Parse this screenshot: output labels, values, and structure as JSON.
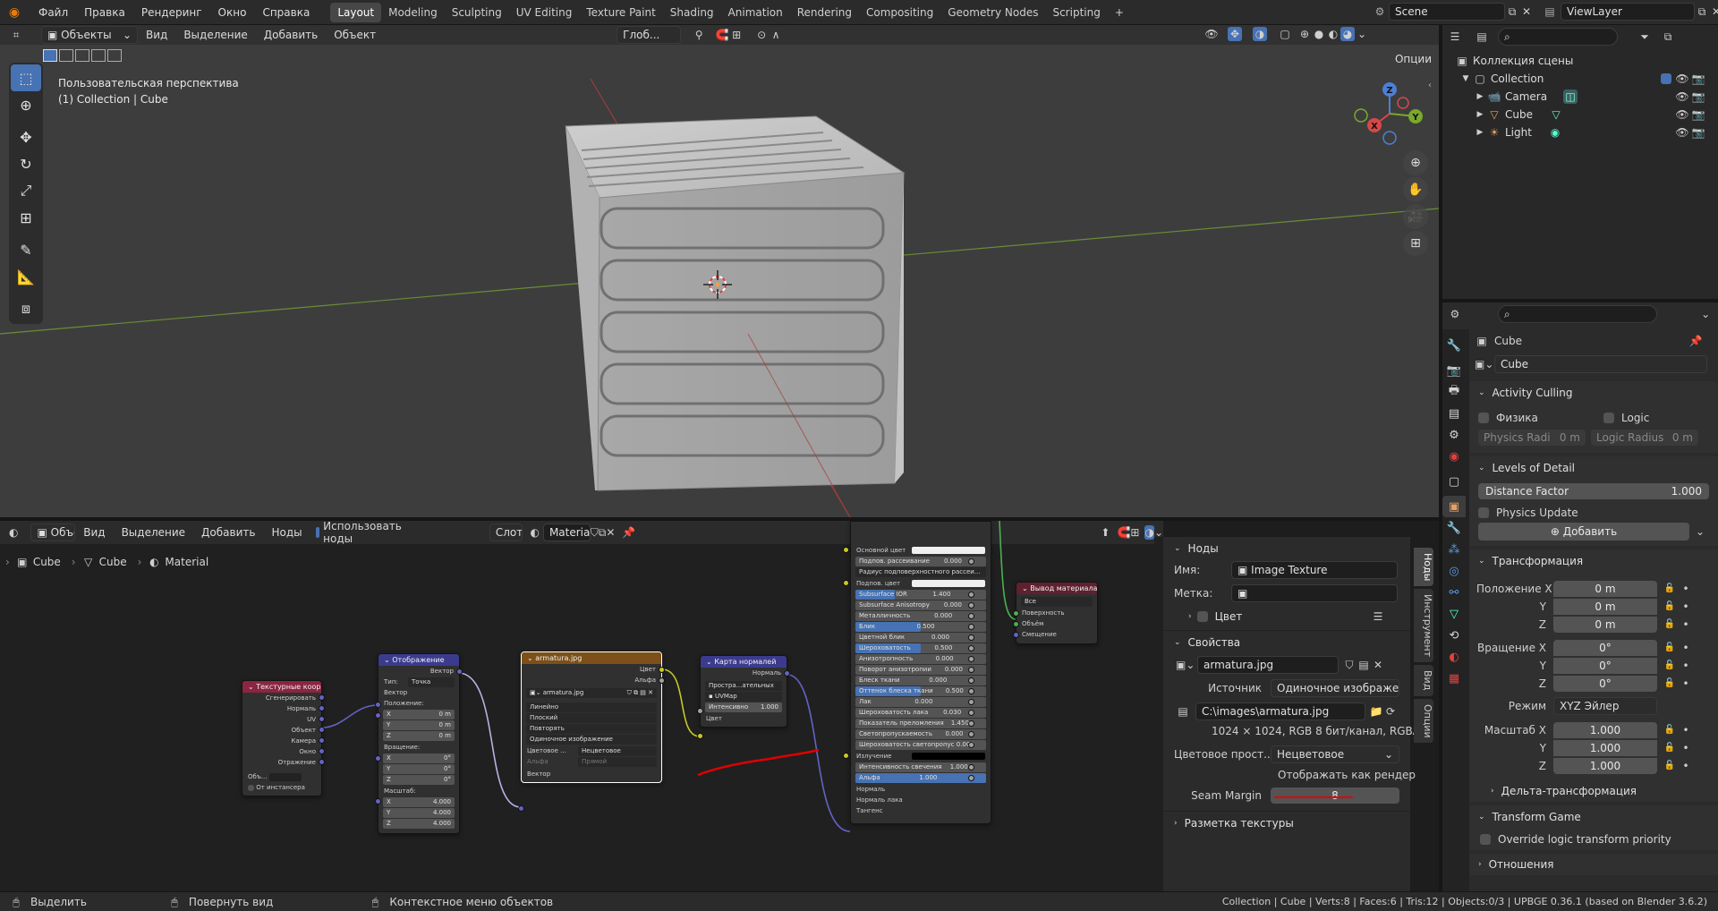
{
  "topbar": {
    "menus": [
      "Файл",
      "Правка",
      "Рендеринг",
      "Окно",
      "Справка"
    ],
    "workspaces": [
      "Layout",
      "Modeling",
      "Sculpting",
      "UV Editing",
      "Texture Paint",
      "Shading",
      "Animation",
      "Rendering",
      "Compositing",
      "Geometry Nodes",
      "Scripting"
    ],
    "add_workspace": "+",
    "scene": "Scene",
    "view_layer": "ViewLayer"
  },
  "viewport": {
    "mode": "Объекты",
    "menus": [
      "Вид",
      "Выделение",
      "Добавить",
      "Объект"
    ],
    "transform_orientation": "Глоб...",
    "options": "Опции",
    "overlay_title": "Пользовательская перспектива",
    "overlay_subtitle": "(1) Collection | Cube",
    "gizmo_labels": {
      "x": "X",
      "y": "Y",
      "z": "Z"
    }
  },
  "outliner": {
    "root": "Коллекция сцены",
    "collection": "Collection",
    "items": [
      "Camera",
      "Cube",
      "Light"
    ]
  },
  "node_editor": {
    "mode": "Объект",
    "menus": [
      "Вид",
      "Выделение",
      "Добавить",
      "Ноды"
    ],
    "use_nodes": "Использовать ноды",
    "slot": "Слот 1",
    "material": "Material",
    "breadcrumb": [
      "Cube",
      "Cube",
      "Material"
    ],
    "nodes": {
      "texcoord": {
        "title": "Текстурные коорд...",
        "outputs": [
          "Сгенерировать",
          "Нормаль",
          "UV",
          "Объект",
          "Камера",
          "Окно",
          "Отражение"
        ],
        "object_label": "Объ...",
        "from_instancer": "От инстансера"
      },
      "mapping": {
        "title": "Отображение",
        "output": "Вектор",
        "type_label": "Тип:",
        "type_value": "Точка",
        "vector": "Вектор",
        "location": "Положение:",
        "loc": [
          [
            "X",
            "0 m"
          ],
          [
            "Y",
            "0 m"
          ],
          [
            "Z",
            "0 m"
          ]
        ],
        "rotation": "Вращение:",
        "rot": [
          [
            "X",
            "0°"
          ],
          [
            "Y",
            "0°"
          ],
          [
            "Z",
            "0°"
          ]
        ],
        "scale": "Масштаб:",
        "scl": [
          [
            "X",
            "4.000"
          ],
          [
            "Y",
            "4.000"
          ],
          [
            "Z",
            "4.000"
          ]
        ]
      },
      "image": {
        "title": "armatura.jpg",
        "outputs": [
          "Цвет",
          "Альфа"
        ],
        "image_name": "armatura.jpg",
        "interpolation": "Линейно",
        "projection": "Плоский",
        "extension": "Повторять",
        "source": "Одиночное изображение",
        "colorspace_label": "Цветовое ...",
        "colorspace_value": "Нецветовое",
        "alpha_label": "Альфа",
        "alpha_value": "Прямой",
        "vector_in": "Вектор"
      },
      "normalmap": {
        "title": "Карта нормалей",
        "output": "Нормаль",
        "space": "Простра...ательных",
        "uvmap": "UVMap",
        "strength_label": "Интенсивно",
        "strength_value": "1.000",
        "color_in": "Цвет"
      },
      "bsdf": {
        "rows": [
          {
            "label": "Основной цвет",
            "kind": "color",
            "color": "#f0f0f0"
          },
          {
            "label": "Подпов. рассеивание",
            "value": "0.000"
          },
          {
            "label": "Радиус подповерхностного рассеи...",
            "kind": "dd"
          },
          {
            "label": "Подпов. цвет",
            "kind": "color",
            "color": "#f0f0f0"
          },
          {
            "label": "Subsurface IOR",
            "value": "1.400",
            "fill": 0.3
          },
          {
            "label": "Subsurface Anisotropy",
            "value": "0.000"
          },
          {
            "label": "Металличность",
            "value": "0.000"
          },
          {
            "label": "Блик",
            "value": "0.500",
            "fill": 0.5
          },
          {
            "label": "Цветной блик",
            "value": "0.000"
          },
          {
            "label": "Шероховатость",
            "value": "0.500",
            "fill": 0.5
          },
          {
            "label": "Анизотропность",
            "value": "0.000"
          },
          {
            "label": "Поворот анизотропии",
            "value": "0.000"
          },
          {
            "label": "Блеск ткани",
            "value": "0.000"
          },
          {
            "label": "Оттенок блеска ткани",
            "value": "0.500",
            "fill": 0.5
          },
          {
            "label": "Лак",
            "value": "0.000"
          },
          {
            "label": "Шероховатость лака",
            "value": "0.030"
          },
          {
            "label": "Показатель преломления",
            "value": "1.450"
          },
          {
            "label": "Светопропускаемость",
            "value": "0.000"
          },
          {
            "label": "Шероховатость светопропус",
            "value": "0.000"
          },
          {
            "label": "Излучение",
            "kind": "color",
            "color": "#000000"
          },
          {
            "label": "Интенсивность свечения",
            "value": "1.000"
          },
          {
            "label": "Альфа",
            "value": "1.000",
            "fill": 1.0
          },
          {
            "label": "Нормаль",
            "kind": "socket"
          },
          {
            "label": "Нормаль лака",
            "kind": "socket"
          },
          {
            "label": "Тангенс",
            "kind": "socket"
          }
        ]
      },
      "output": {
        "title": "Вывод материала",
        "target": "Все",
        "inputs": [
          "Поверхность",
          "Объём",
          "Смещение"
        ]
      }
    }
  },
  "npanel": {
    "nodes_header": "Ноды",
    "name_label": "Имя:",
    "name_value": "Image Texture",
    "label_label": "Метка:",
    "label_value": "",
    "color_header": "Цвет",
    "props_header": "Свойства",
    "image_name": "armatura.jpg",
    "source_label": "Источник",
    "source_value": "Одиночное изображе...",
    "filepath": "C:\\images\\armatura.jpg",
    "info": "1024 × 1024,  RGB 8 бит/канал,  RGBA8",
    "colorspace_label": "Цветовое прост...",
    "colorspace_value": "Нецветовое",
    "view_as_render": "Отображать как рендер",
    "seam_label": "Seam Margin",
    "seam_value": "8",
    "texmap_header": "Разметка текстуры",
    "tabs": [
      "Ноды",
      "Инструмент",
      "Вид",
      "Опции"
    ]
  },
  "properties": {
    "object_name": "Cube",
    "data_name": "Cube",
    "activity_culling": "Activity Culling",
    "physics": "Физика",
    "logic": "Logic",
    "physics_radius_label": "Physics Radi",
    "physics_radius_value": "0 m",
    "logic_radius_label": "Logic Radius",
    "logic_radius_value": "0 m",
    "lod": "Levels of Detail",
    "distance_factor_label": "Distance Factor",
    "distance_factor_value": "1.000",
    "physics_update": "Physics Update",
    "add_button": "Добавить",
    "transform": "Трансформация",
    "location_label": "Положение X",
    "location": [
      "0 m",
      "0 m",
      "0 m"
    ],
    "rotation_label": "Вращение X",
    "rotation": [
      "0°",
      "0°",
      "0°"
    ],
    "mode_label": "Режим",
    "mode_value": "XYZ Эйлер",
    "scale_label": "Масштаб X",
    "scale": [
      "1.000",
      "1.000",
      "1.000"
    ],
    "axis_y": "Y",
    "axis_z": "Z",
    "delta": "Дельта-трансформация",
    "transform_game": "Transform Game",
    "override": "Override logic transform priority",
    "relations": "Отношения"
  },
  "statusbar": {
    "select": "Выделить",
    "rotate": "Повернуть вид",
    "context": "Контекстное меню объектов",
    "stats": "Collection | Cube | Verts:8 | Faces:6 | Tris:12 | Objects:0/3 | UPBGE 0.36.1 (based on Blender 3.6.2)"
  },
  "colors": {
    "accent": "#4772b3",
    "node_texture": "#7c5018",
    "node_vector": "#3b3b8e",
    "node_input": "#8b2542",
    "node_output": "#5f2130",
    "annotation": "#e00000"
  }
}
